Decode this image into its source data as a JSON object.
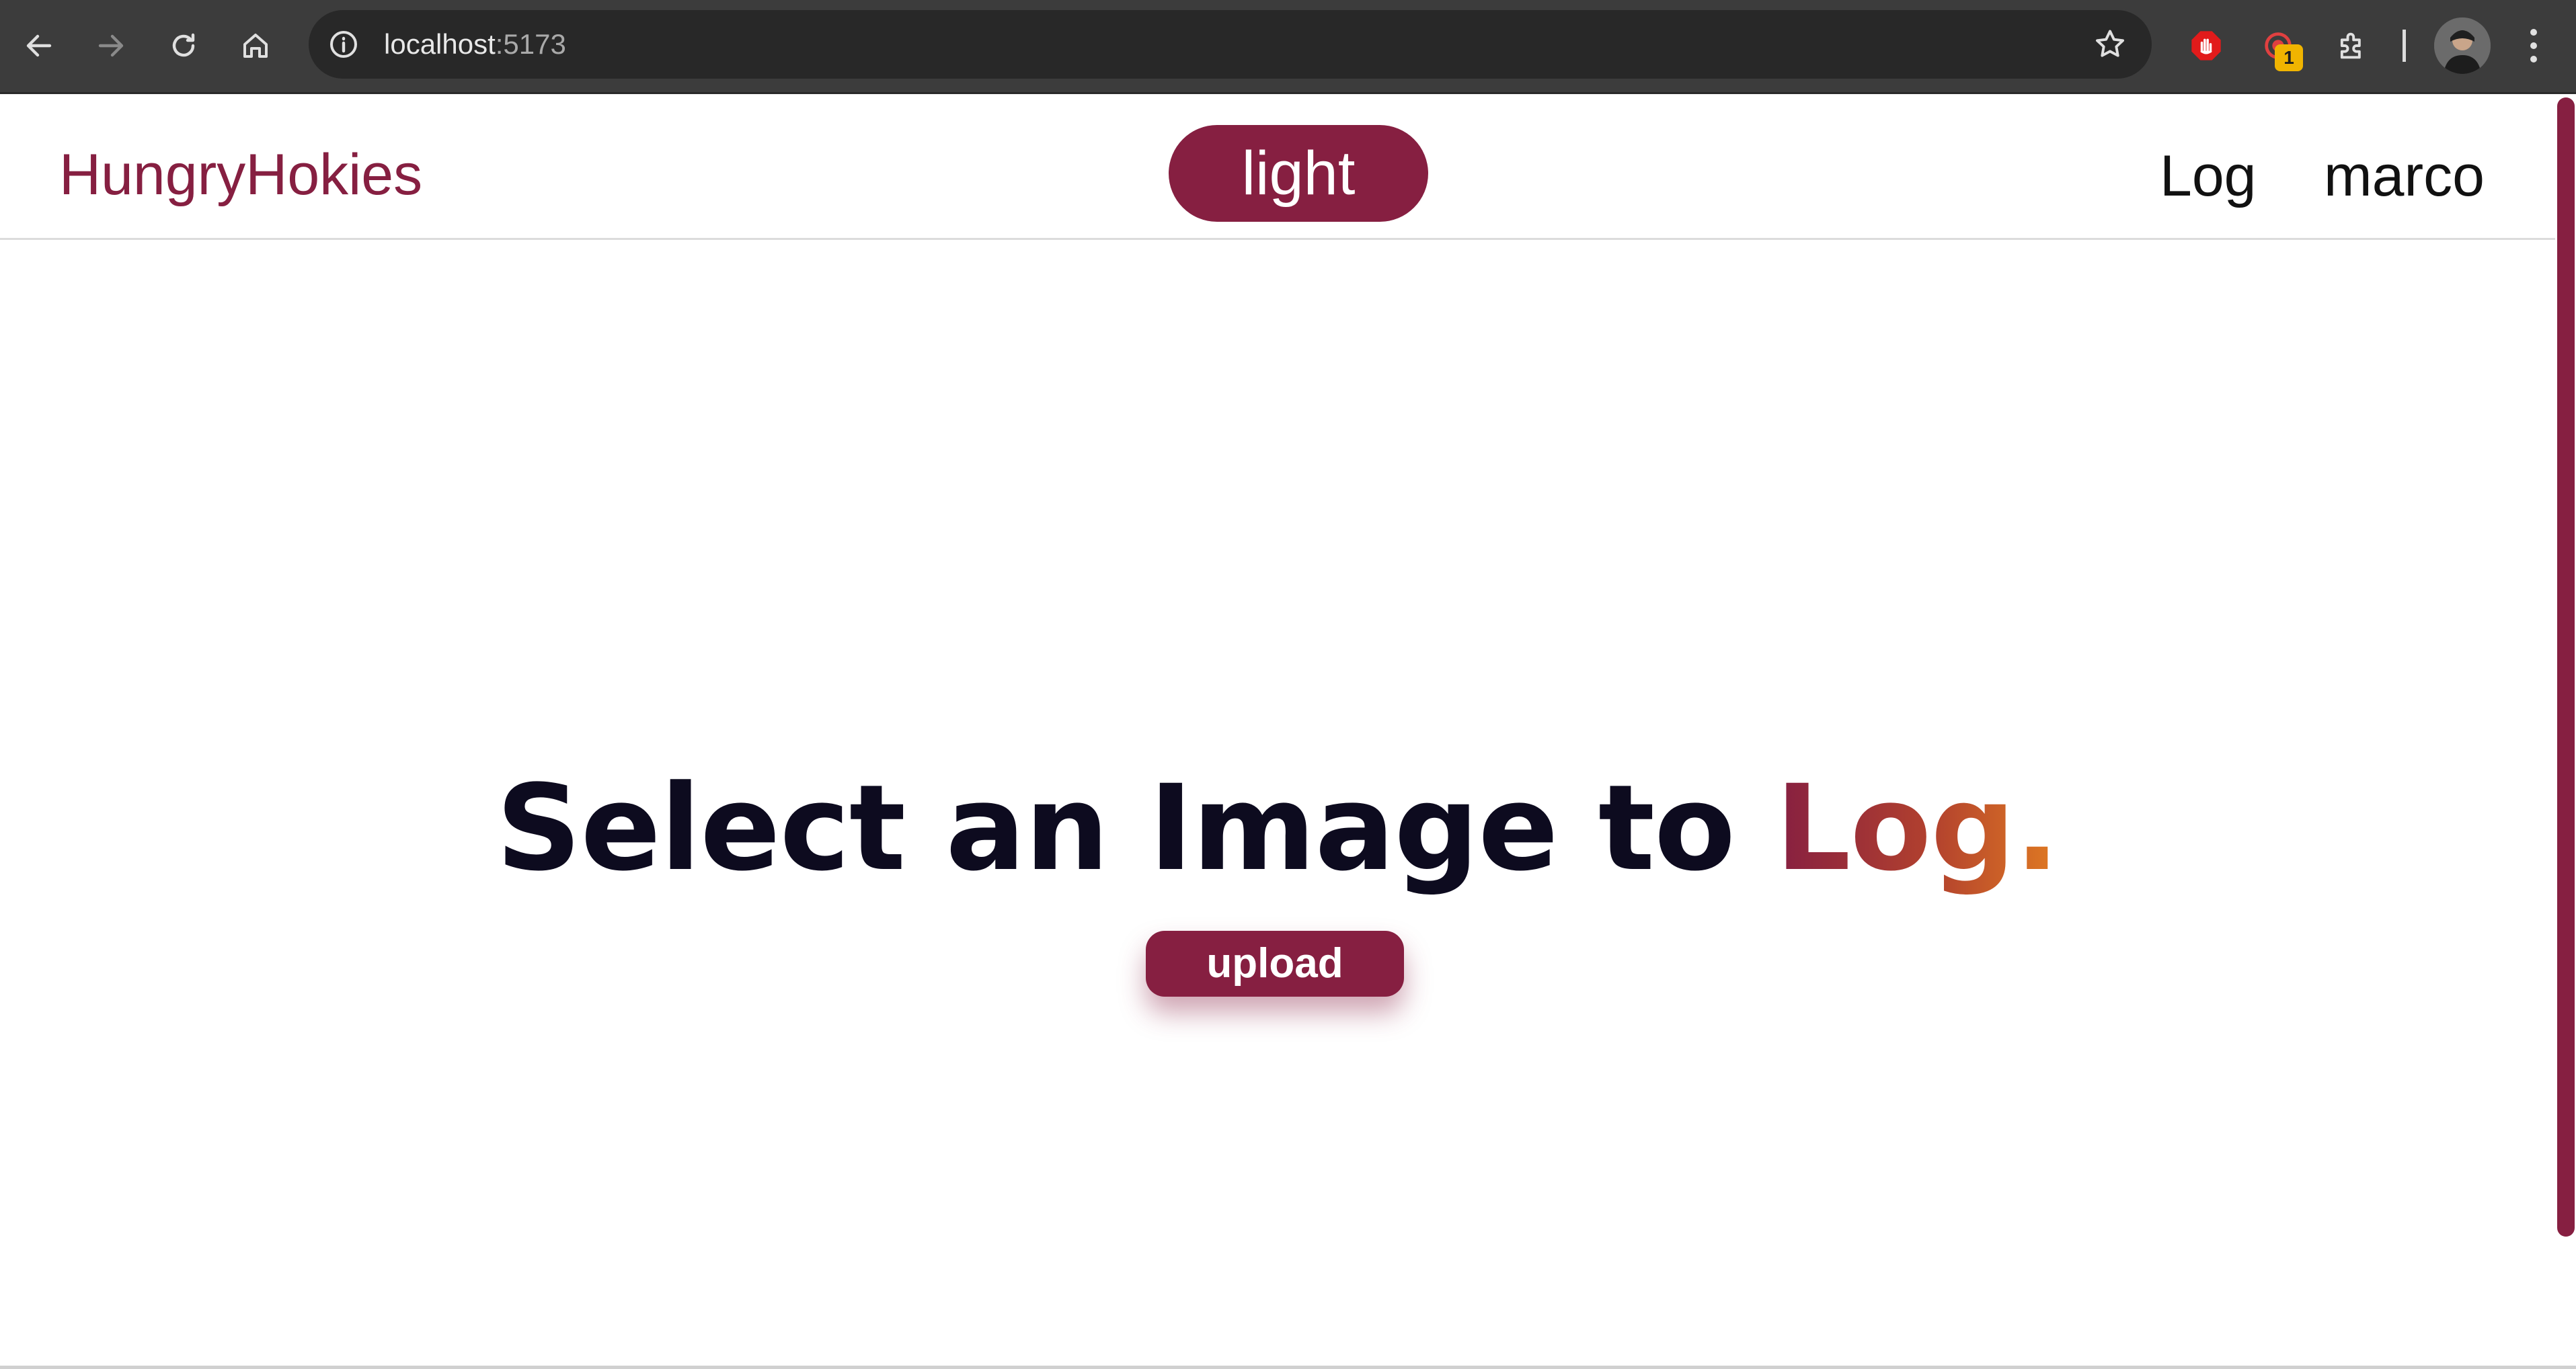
{
  "browser": {
    "url_host": "localhost",
    "url_port": ":5173",
    "extension_badge": "1",
    "buttons": {
      "back": "back-arrow-icon",
      "forward": "forward-arrow-icon",
      "reload": "reload-icon",
      "home": "home-icon",
      "site_info": "info-icon",
      "bookmark": "star-icon",
      "extensions": "puzzle-icon",
      "menu": "kebab-menu-icon"
    }
  },
  "header": {
    "brand": "HungryHokies",
    "theme_toggle": "light",
    "nav": [
      "Log",
      "marco"
    ]
  },
  "hero": {
    "title_main": "Select an Image to ",
    "title_accent": "Log.",
    "upload_label": "upload"
  },
  "colors": {
    "brand": "#861f41",
    "accent_gradient_end": "#e07a22",
    "text_dark": "#0d0b1f"
  }
}
